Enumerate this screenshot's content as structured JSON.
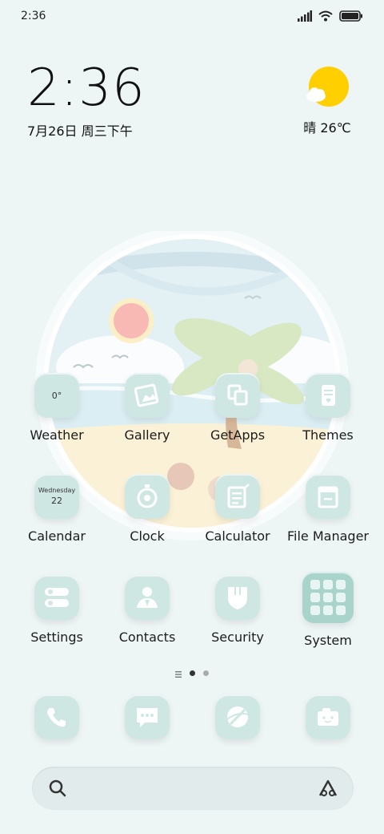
{
  "status_bar": {
    "time": "2:36"
  },
  "clock_widget": {
    "time": "2:36",
    "date": "7月26日 周三下午"
  },
  "weather_widget": {
    "text": "晴 26℃"
  },
  "apps": [
    {
      "label": "Weather",
      "icon": "weather-icon",
      "badge": "0°"
    },
    {
      "label": "Gallery",
      "icon": "gallery-icon"
    },
    {
      "label": "GetApps",
      "icon": "getapps-icon"
    },
    {
      "label": "Themes",
      "icon": "themes-icon"
    },
    {
      "label": "Calendar",
      "icon": "calendar-icon",
      "day_name": "Wednesday",
      "day_num": "22"
    },
    {
      "label": "Clock",
      "icon": "clock-icon"
    },
    {
      "label": "Calculator",
      "icon": "calculator-icon"
    },
    {
      "label": "File Manager",
      "icon": "file-manager-icon"
    },
    {
      "label": "Settings",
      "icon": "settings-icon"
    },
    {
      "label": "Contacts",
      "icon": "contacts-icon"
    },
    {
      "label": "Security",
      "icon": "security-icon"
    },
    {
      "label": "System",
      "icon": "system-folder-icon"
    }
  ],
  "dock": [
    {
      "icon": "phone-icon"
    },
    {
      "icon": "messages-icon"
    },
    {
      "icon": "browser-icon"
    },
    {
      "icon": "camera-icon"
    }
  ],
  "colors": {
    "tile": "#cfe7e3",
    "tile_icon": "#ffffff",
    "background": "#eef5f5",
    "sun": "#ffcf00"
  }
}
